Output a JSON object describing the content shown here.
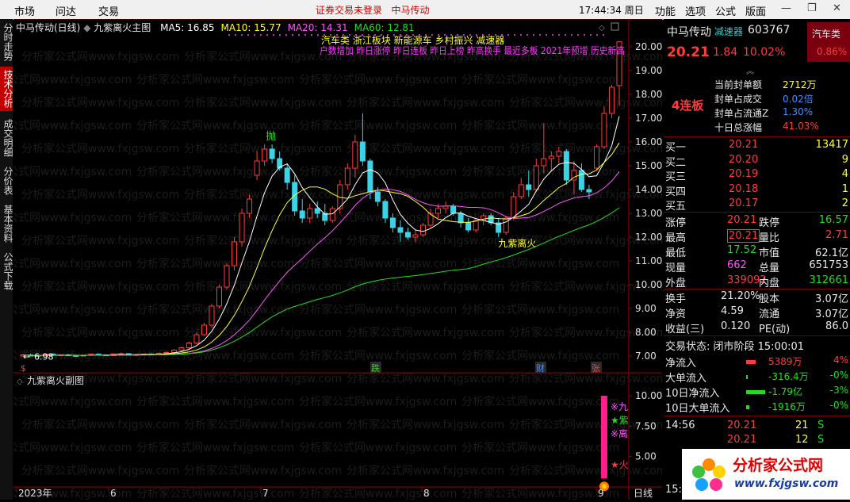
{
  "menubar": {
    "items": [
      "市场",
      "问达",
      "交易"
    ],
    "notice": "证券交易未登录",
    "stock": "中马传动",
    "clock": "17:44:34 周日",
    "right_items": [
      "功能",
      "选项",
      "公式",
      "版面"
    ]
  },
  "left_tabs": [
    "分时走势",
    "技术分析",
    "成交明细",
    "分价表",
    "基本资料",
    "公式下载"
  ],
  "chart": {
    "title": "中马传动(日线)",
    "indicator": "九紫离火主图",
    "ma": [
      {
        "label": "MA5: 16.85",
        "color": "#ffffff"
      },
      {
        "label": "MA10: 15.77",
        "color": "#ffff33"
      },
      {
        "label": "MA20: 14.31",
        "color": "#ff55ff"
      },
      {
        "label": "MA60: 12.81",
        "color": "#22dd22"
      }
    ],
    "concepts": "汽车类 浙江板块 新能源车 乡村振兴 减速器",
    "banner": "户数增加 昨日涨停 昨日连板 昨日上榜 昨高换手 最近多板 2021年预增 历史新高",
    "signal_sell": "抛",
    "signal_name": "九紫离火",
    "low_marker": "6.98",
    "price_axis": [
      "20.00",
      "19.00",
      "18.00",
      "17.00",
      "16.00",
      "15.00",
      "14.00",
      "13.00",
      "12.00",
      "11.00",
      "10.00",
      "9.00",
      "8.00",
      "7.00"
    ],
    "events": [
      "$",
      "跌",
      "财",
      "张"
    ],
    "sub_title": "九紫离火副图",
    "sub_axis": [
      "10.00",
      "7.50",
      "5.00"
    ],
    "sub_labels": [
      "※九",
      "★紫",
      "※离",
      "★火"
    ],
    "time_axis": [
      "2023年",
      "6",
      "7",
      "8",
      "9"
    ],
    "period_button": "日线",
    "watermark": "分析家公式网www.fxjgsw.com"
  },
  "panel": {
    "name": "中马传动",
    "sector": "减速器",
    "code": "603767",
    "industry": "汽车类",
    "price": "20.21",
    "change": "1.84",
    "pct": "10.02%",
    "industry_pct": "0.86%",
    "board": "4连板",
    "seal": [
      {
        "label": "当前封单额",
        "value": "2712万"
      },
      {
        "label": "封单占成交",
        "value": "0.02倍"
      },
      {
        "label": "封单占流通Z",
        "value": "1.30%"
      },
      {
        "label": "十日总涨幅",
        "value": "41.03%"
      }
    ],
    "bids": [
      {
        "label": "买一",
        "price": "20.21",
        "vol": "13417"
      },
      {
        "label": "买二",
        "price": "20.20",
        "vol": "9"
      },
      {
        "label": "买三",
        "price": "20.19",
        "vol": "4"
      },
      {
        "label": "买四",
        "price": "20.18",
        "vol": "1"
      },
      {
        "label": "买五",
        "price": "20.17",
        "vol": "2"
      }
    ],
    "stats": [
      [
        "涨停",
        "20.21",
        "跌停",
        "16.57"
      ],
      [
        "最高",
        "20.21",
        "量比",
        "2.71"
      ],
      [
        "最低",
        "17.52",
        "市值",
        "62.1亿"
      ],
      [
        "现量",
        "662",
        "总量",
        "651753"
      ],
      [
        "外盘",
        "339092",
        "内盘",
        "312661"
      ]
    ],
    "stats2": [
      [
        "换手",
        "21.20%",
        "股本",
        "3.07亿"
      ],
      [
        "净资",
        "4.59",
        "流通",
        "3.07亿"
      ],
      [
        "收益(三)",
        "0.120",
        "PE(动)",
        "86.0"
      ]
    ],
    "trade_status": "交易状态: 闭市阶段 15:00:01",
    "flows": [
      {
        "label": "净流入",
        "value": "5389万",
        "pct": "4%",
        "bar": 0.3,
        "color": "#ff3b3b"
      },
      {
        "label": "大单流入",
        "value": "-316.4万",
        "pct": "-0%",
        "bar": 0.05,
        "color": "#22dd22"
      },
      {
        "label": "10日净流入",
        "value": "-1.79亿",
        "pct": "-3%",
        "bar": 0.6,
        "color": "#22dd22"
      },
      {
        "label": "10日大单流入",
        "value": "-1916万",
        "pct": "-0%",
        "bar": 0.1,
        "color": "#22dd22"
      }
    ],
    "ticks": [
      {
        "time": "14:56",
        "price": "20.21",
        "vol": "21",
        "side": "S"
      },
      {
        "time": "",
        "price": "20.21",
        "vol": "12",
        "side": "S"
      },
      {
        "time": "",
        "price": "20.21",
        "vol": "",
        "side": ""
      }
    ],
    "tick_footer": "15:"
  },
  "logo": {
    "line1": "分析家公式网",
    "line2": "www.fxjgsw.com"
  },
  "chart_data": {
    "type": "candlestick",
    "ylim": [
      6.5,
      20.5
    ],
    "candles": [
      [
        7.0,
        7.1,
        6.98,
        7.05
      ],
      [
        7.05,
        7.1,
        7.0,
        7.0
      ],
      [
        7.0,
        7.05,
        6.98,
        7.02
      ],
      [
        7.02,
        7.1,
        7.0,
        7.08
      ],
      [
        7.08,
        7.12,
        7.0,
        7.03
      ],
      [
        7.03,
        7.08,
        7.0,
        7.05
      ],
      [
        7.05,
        7.1,
        7.02,
        7.02
      ],
      [
        7.02,
        7.05,
        6.98,
        7.0
      ],
      [
        7.0,
        7.06,
        6.98,
        7.04
      ],
      [
        7.04,
        7.1,
        7.0,
        7.08
      ],
      [
        7.08,
        7.12,
        7.02,
        7.05
      ],
      [
        7.05,
        7.08,
        7.0,
        7.02
      ],
      [
        7.02,
        7.1,
        7.0,
        7.09
      ],
      [
        7.09,
        7.15,
        7.05,
        7.1
      ],
      [
        7.1,
        7.12,
        7.02,
        7.04
      ],
      [
        7.04,
        7.1,
        7.0,
        7.06
      ],
      [
        7.06,
        7.1,
        7.02,
        7.08
      ],
      [
        7.08,
        7.12,
        7.05,
        7.07
      ],
      [
        7.07,
        7.15,
        7.05,
        7.12
      ],
      [
        7.12,
        7.2,
        7.08,
        7.15
      ],
      [
        7.15,
        7.3,
        7.1,
        7.25
      ],
      [
        7.25,
        7.4,
        7.2,
        7.35
      ],
      [
        7.35,
        7.6,
        7.3,
        7.55
      ],
      [
        7.55,
        8.0,
        7.5,
        7.9
      ],
      [
        7.9,
        8.4,
        7.85,
        8.3
      ],
      [
        8.3,
        9.2,
        8.2,
        9.1
      ],
      [
        9.1,
        10.0,
        9.0,
        9.9
      ],
      [
        9.9,
        10.9,
        9.8,
        10.8
      ],
      [
        10.8,
        12.0,
        10.6,
        11.8
      ],
      [
        11.8,
        13.2,
        11.6,
        13.0
      ],
      [
        13.0,
        13.8,
        12.8,
        13.6
      ],
      [
        14.6,
        15.6,
        14.4,
        15.2
      ],
      [
        15.2,
        15.9,
        15.0,
        15.7
      ],
      [
        15.7,
        15.9,
        15.1,
        15.3
      ],
      [
        15.3,
        15.6,
        14.8,
        14.9
      ],
      [
        14.9,
        15.1,
        14.0,
        14.3
      ],
      [
        14.3,
        14.6,
        12.9,
        13.1
      ],
      [
        13.1,
        13.6,
        12.6,
        12.8
      ],
      [
        12.8,
        13.4,
        12.6,
        13.2
      ],
      [
        13.2,
        13.5,
        12.8,
        13.0
      ],
      [
        13.0,
        13.4,
        12.5,
        12.7
      ],
      [
        12.7,
        13.3,
        12.6,
        13.2
      ],
      [
        13.2,
        14.4,
        13.0,
        14.2
      ],
      [
        14.2,
        15.1,
        14.0,
        14.9
      ],
      [
        14.9,
        16.3,
        14.5,
        16.0
      ],
      [
        16.0,
        17.2,
        15.0,
        15.2
      ],
      [
        15.2,
        15.3,
        13.6,
        13.9
      ],
      [
        13.9,
        14.1,
        13.3,
        13.5
      ],
      [
        13.5,
        13.6,
        12.6,
        12.8
      ],
      [
        12.8,
        13.0,
        12.2,
        12.4
      ],
      [
        12.4,
        12.7,
        11.8,
        12.2
      ],
      [
        12.2,
        12.4,
        11.9,
        12.0
      ],
      [
        12.0,
        12.3,
        11.8,
        12.1
      ],
      [
        12.1,
        12.6,
        12.0,
        12.5
      ],
      [
        12.5,
        13.2,
        12.4,
        13.0
      ],
      [
        13.0,
        13.4,
        12.8,
        13.2
      ],
      [
        13.2,
        13.5,
        13.0,
        13.3
      ],
      [
        13.3,
        13.4,
        12.9,
        13.0
      ],
      [
        13.0,
        13.1,
        12.4,
        12.6
      ],
      [
        12.6,
        12.8,
        12.2,
        12.3
      ],
      [
        12.3,
        12.8,
        12.2,
        12.7
      ],
      [
        12.7,
        13.0,
        12.5,
        12.9
      ],
      [
        12.9,
        13.0,
        12.5,
        12.6
      ],
      [
        12.6,
        12.8,
        12.0,
        12.2
      ],
      [
        12.2,
        12.9,
        12.1,
        12.8
      ],
      [
        12.8,
        13.9,
        12.7,
        13.7
      ],
      [
        13.7,
        14.5,
        13.6,
        14.2
      ],
      [
        14.2,
        14.8,
        13.7,
        14.0
      ],
      [
        14.0,
        15.3,
        13.9,
        15.0
      ],
      [
        15.0,
        16.8,
        14.7,
        15.3
      ],
      [
        15.3,
        15.6,
        14.8,
        15.4
      ],
      [
        15.4,
        15.8,
        15.1,
        15.6
      ],
      [
        15.6,
        15.7,
        14.2,
        14.4
      ],
      [
        14.4,
        15.2,
        13.8,
        14.8
      ],
      [
        14.8,
        15.1,
        13.9,
        14.0
      ],
      [
        14.0,
        14.2,
        13.6,
        13.9
      ],
      [
        14.9,
        15.9,
        14.8,
        15.8
      ],
      [
        15.8,
        17.5,
        15.7,
        17.2
      ],
      [
        17.2,
        18.4,
        17.0,
        18.3
      ],
      [
        18.37,
        20.21,
        17.52,
        20.21
      ]
    ],
    "ma_series": [
      {
        "name": "MA5",
        "color": "#ffffff"
      },
      {
        "name": "MA10",
        "color": "#ffff33"
      },
      {
        "name": "MA20",
        "color": "#ff55ff"
      },
      {
        "name": "MA60",
        "color": "#22dd22"
      }
    ],
    "sub_ylim": [
      2.5,
      11.5
    ],
    "sub_bar": {
      "index": 77,
      "top": 10.0,
      "bottom": 3.2
    }
  }
}
